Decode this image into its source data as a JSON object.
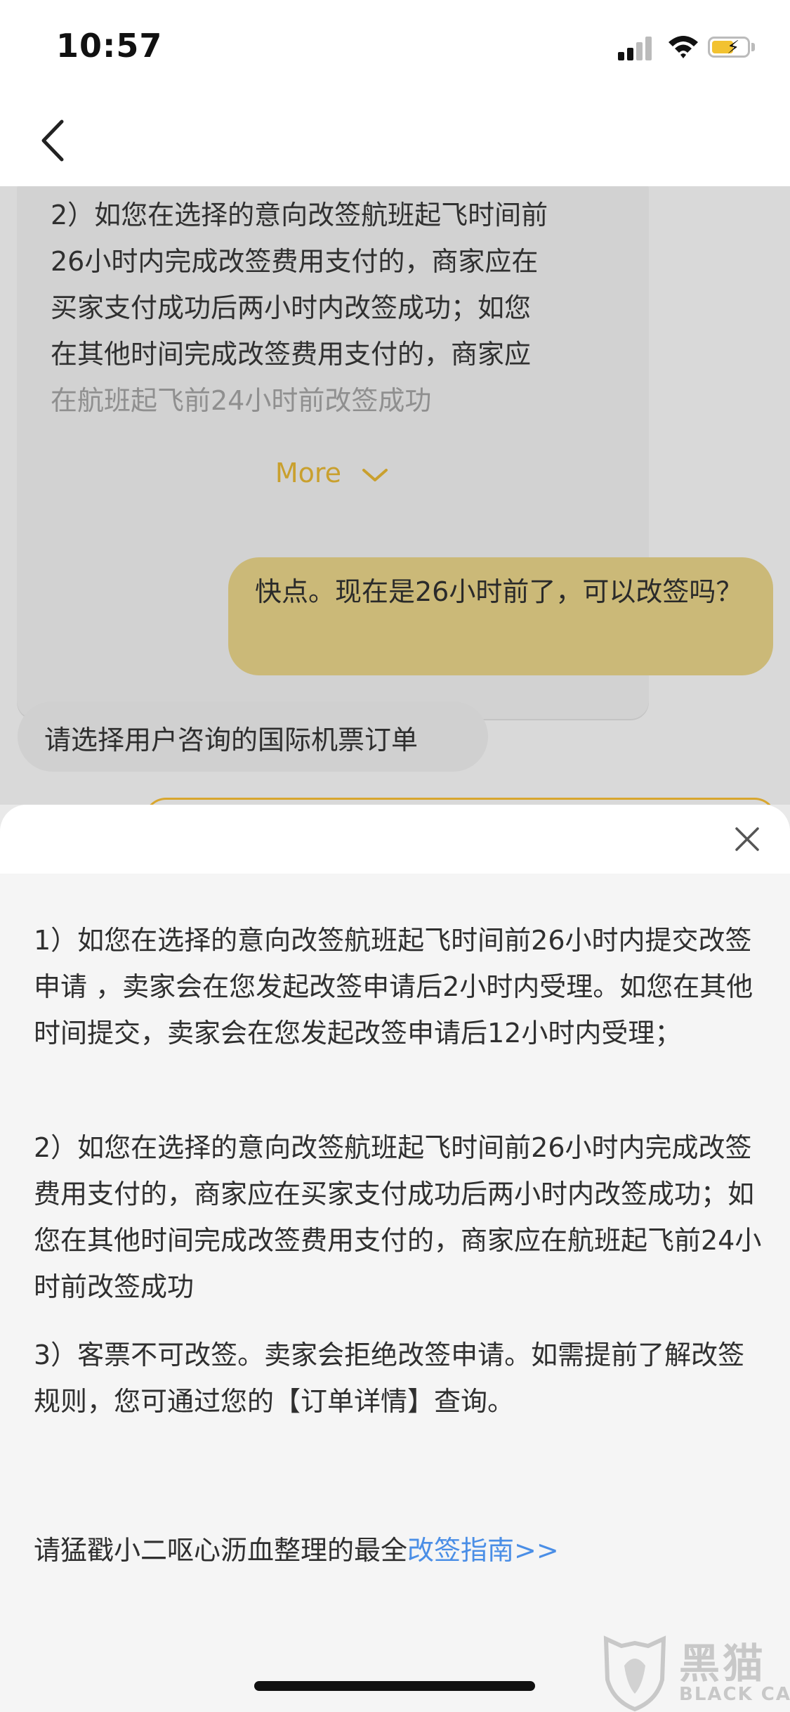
{
  "status_bar": {
    "time": "10:57",
    "icons": [
      "signal-icon",
      "wifi-icon",
      "battery-charging-icon"
    ]
  },
  "nav": {
    "back_icon": "chevron-left-icon"
  },
  "chat": {
    "card": {
      "lines": [
        "2）如您在选择的意向改签航班起飞时间前",
        "26小时内完成改签费用支付的，商家应在",
        "买家支付成功后两小时内改签成功；如您",
        "在其他时间完成改签费用支付的，商家应"
      ],
      "faded_line": "在航班起飞前24小时前改签成功",
      "more_label": "More",
      "more_icon": "chevron-down-icon"
    },
    "user_message": "快点。现在是26小时前了，可以改签吗？",
    "bot_message": "请选择用户咨询的国际机票订单"
  },
  "sheet": {
    "close_icon": "close-icon",
    "items": [
      "1）如您在选择的意向改签航班起飞时间前26小时内提交改签申请 ，卖家会在您发起改签申请后2小时内受理。如您在其他时间提交，卖家会在您发起改签申请后12小时内受理；",
      "2）如您在选择的意向改签航班起飞时间前26小时内完成改签费用支付的，商家应在买家支付成功后两小时内改签成功；如您在其他时间完成改签费用支付的，商家应在航班起飞前24小时前改签成功",
      "3）客票不可改签。卖家会拒绝改签申请。如需提前了解改签规则，您可通过您的【订单详情】查询。"
    ],
    "guide_text": "请猛戳小二呕心沥血整理的最全",
    "guide_link": "改签指南>>"
  },
  "watermark": {
    "cn": "黑猫",
    "en": "BLACK CAT"
  },
  "colors": {
    "accent_gold": "#c9a02e",
    "user_bubble": "#cbb978",
    "link_blue": "#4a8ee6"
  }
}
